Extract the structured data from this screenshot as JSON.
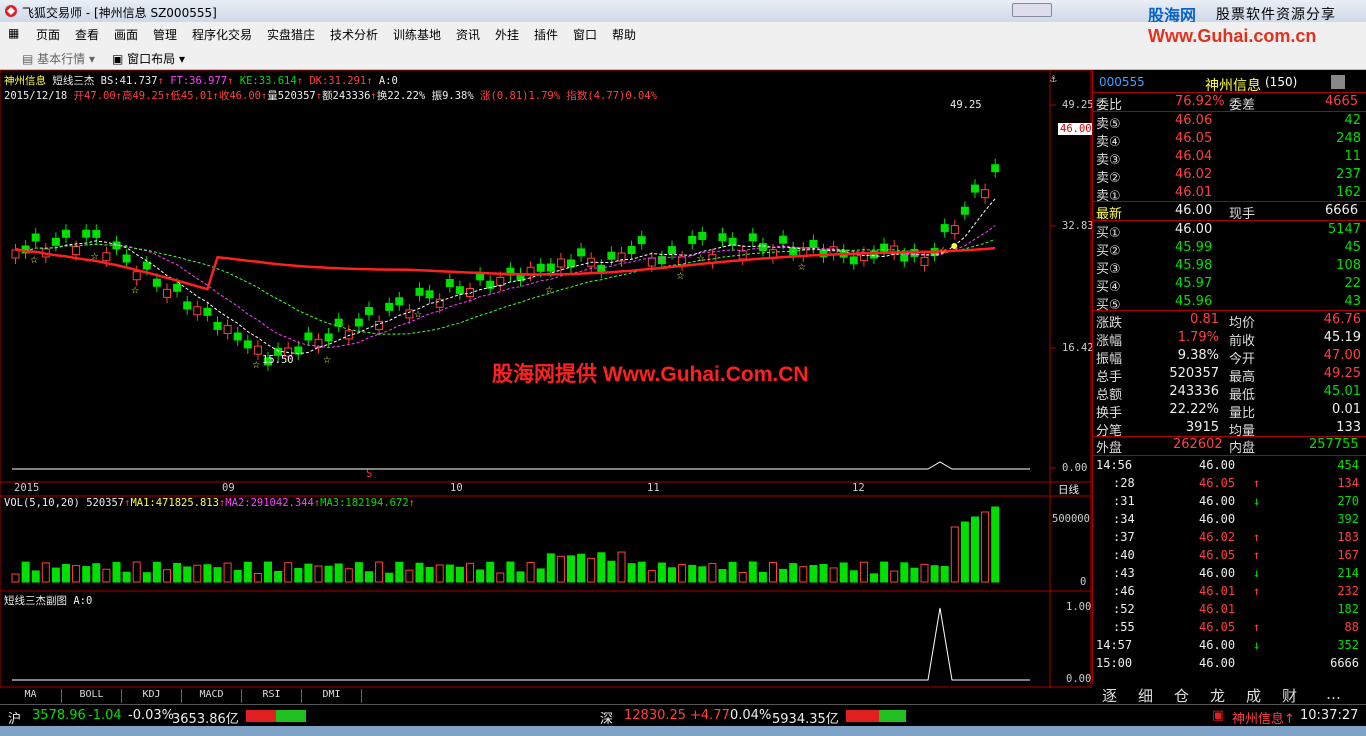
{
  "app": {
    "title": "飞狐交易师 - [神州信息 SZ000555]",
    "brand_cn": "股海网",
    "brand_slogan": "股票软件资源分享",
    "brand_url": "Www.Guhai.com.cn",
    "watermark": "股海网提供 Www.Guhai.Com.CN"
  },
  "menu": [
    "页面",
    "查看",
    "画面",
    "管理",
    "程序化交易",
    "实盘猎庄",
    "技术分析",
    "训练基地",
    "资讯",
    "外挂",
    "插件",
    "窗口",
    "帮助"
  ],
  "toolbar": {
    "market": "基本行情",
    "layout": "窗口布局"
  },
  "chart_header": {
    "stock": "神州信息",
    "indicator": "短线三杰",
    "bs": "BS:41.737",
    "ft": "FT:36.977",
    "ke": "KE:33.614",
    "dk": "DK:31.291",
    "a": "A:0",
    "date": "2015/12/18",
    "open": "开47.00",
    "high": "高49.25",
    "low": "低45.01",
    "close": "收46.00",
    "vol": "量520357",
    "amount": "额243336",
    "turnover": "换22.22%",
    "amplitude": "振9.38%",
    "change": "涨(0.81)1.79%",
    "index": "指数(4.77)0.04%"
  },
  "price_axis": {
    "labels": [
      "49.25",
      "32.83",
      "16.42",
      "0.00"
    ],
    "current": "46.00",
    "high_mark": "49.25",
    "low_mark": "15.50"
  },
  "date_axis": {
    "labels": [
      "2015",
      "09",
      "10",
      "11",
      "12"
    ],
    "period": "日线",
    "marker": "S"
  },
  "vol_header": {
    "label": "VOL(5,10,20)",
    "value": "520357",
    "ma1": "MA1:471825.813",
    "ma2": "MA2:291042.344",
    "ma3": "MA3:182194.672"
  },
  "vol_axis": [
    "500000",
    "0"
  ],
  "sub_header": {
    "label": "短线三杰副图",
    "a": "A:0"
  },
  "sub_axis": [
    "1.00",
    "0.00"
  ],
  "bottom_tabs": [
    "MA",
    "BOLL",
    "KDJ",
    "MACD",
    "RSI",
    "DMI"
  ],
  "quote": {
    "code": "000555",
    "name": "神州信息",
    "count": "(150)",
    "weibi_label": "委比",
    "weibi": "76.92%",
    "weicha_label": "委差",
    "weicha": "4665",
    "asks": [
      {
        "label": "卖⑤",
        "price": "46.06",
        "vol": "42"
      },
      {
        "label": "卖④",
        "price": "46.05",
        "vol": "248"
      },
      {
        "label": "卖③",
        "price": "46.04",
        "vol": "11"
      },
      {
        "label": "卖②",
        "price": "46.02",
        "vol": "237"
      },
      {
        "label": "卖①",
        "price": "46.01",
        "vol": "162"
      }
    ],
    "latest_label": "最新",
    "latest": "46.00",
    "xianshou_label": "现手",
    "xianshou": "6666",
    "bids": [
      {
        "label": "买①",
        "price": "46.00",
        "vol": "5147"
      },
      {
        "label": "买②",
        "price": "45.99",
        "vol": "45"
      },
      {
        "label": "买③",
        "price": "45.98",
        "vol": "108"
      },
      {
        "label": "买④",
        "price": "45.97",
        "vol": "22"
      },
      {
        "label": "买⑤",
        "price": "45.96",
        "vol": "43"
      }
    ],
    "stats": [
      {
        "l1": "涨跌",
        "v1": "0.81",
        "l2": "均价",
        "v2": "46.76",
        "c1": "red",
        "c2": "red"
      },
      {
        "l1": "涨幅",
        "v1": "1.79%",
        "l2": "前收",
        "v2": "45.19",
        "c1": "red",
        "c2": "wht"
      },
      {
        "l1": "振幅",
        "v1": "9.38%",
        "l2": "今开",
        "v2": "47.00",
        "c1": "wht",
        "c2": "red"
      },
      {
        "l1": "总手",
        "v1": "520357",
        "l2": "最高",
        "v2": "49.25",
        "c1": "wht",
        "c2": "red"
      },
      {
        "l1": "总额",
        "v1": "243336",
        "l2": "最低",
        "v2": "45.01",
        "c1": "wht",
        "c2": "grn"
      },
      {
        "l1": "换手",
        "v1": "22.22%",
        "l2": "量比",
        "v2": "0.01",
        "c1": "wht",
        "c2": "wht"
      },
      {
        "l1": "分笔",
        "v1": "3915",
        "l2": "均量",
        "v2": "133",
        "c1": "wht",
        "c2": "wht"
      }
    ],
    "waipan_label": "外盘",
    "waipan": "262602",
    "neipan_label": "内盘",
    "neipan": "257755"
  },
  "ticks": [
    {
      "t": "14:56",
      "p": "46.00",
      "v": "454",
      "d": "",
      "c": "grn"
    },
    {
      "t": ":28",
      "p": "46.05",
      "v": "134",
      "d": "up",
      "c": "red"
    },
    {
      "t": ":31",
      "p": "46.00",
      "v": "270",
      "d": "down",
      "c": "grn"
    },
    {
      "t": ":34",
      "p": "46.00",
      "v": "392",
      "d": "",
      "c": "grn"
    },
    {
      "t": ":37",
      "p": "46.02",
      "v": "183",
      "d": "up",
      "c": "red"
    },
    {
      "t": ":40",
      "p": "46.05",
      "v": "167",
      "d": "up",
      "c": "red"
    },
    {
      "t": ":43",
      "p": "46.00",
      "v": "214",
      "d": "down",
      "c": "grn"
    },
    {
      "t": ":46",
      "p": "46.01",
      "v": "232",
      "d": "up",
      "c": "red"
    },
    {
      "t": ":52",
      "p": "46.01",
      "v": "182",
      "d": "",
      "c": "grn"
    },
    {
      "t": ":55",
      "p": "46.05",
      "v": "88",
      "d": "up",
      "c": "red"
    },
    {
      "t": "14:57",
      "p": "46.00",
      "v": "352",
      "d": "down",
      "c": "grn"
    },
    {
      "t": "15:00",
      "p": "46.00",
      "v": "6666",
      "d": "",
      "c": "wht"
    }
  ],
  "right_tabs": [
    "逐",
    "细",
    "仓",
    "龙",
    "成",
    "财"
  ],
  "status": {
    "sh_label": "沪",
    "sh": "3578.96",
    "sh_chg": "-1.04",
    "sh_pct": "-0.03%",
    "sh_amt": "3653.86亿",
    "sz_label": "深",
    "sz": "12830.25",
    "sz_chg": "+4.77",
    "sz_pct": "0.04%",
    "sz_amt": "5934.35亿",
    "ticker": "神州信息↑",
    "time": "10:37:27"
  },
  "colors": {
    "up": "#ff4040",
    "down": "#00e000",
    "ma_main": "#ff2020",
    "accent_blue": "#0a63c8"
  }
}
